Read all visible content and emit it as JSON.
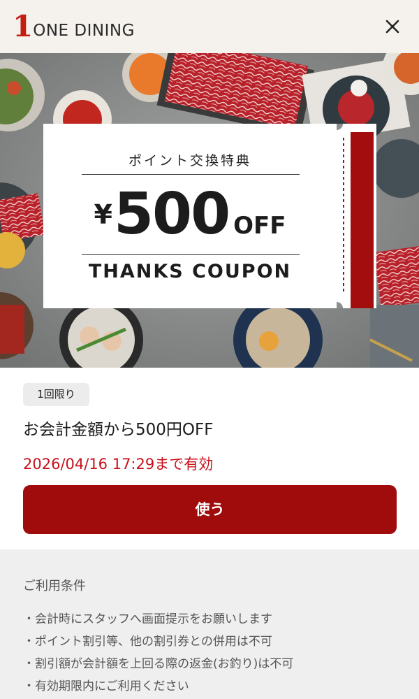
{
  "header": {
    "logo_number": "1",
    "logo_text": "ONE DINING",
    "close_icon": "close-icon"
  },
  "hero": {
    "description_icon": "food-platter-photo"
  },
  "coupon_card": {
    "title": "ポイント交換特典",
    "currency": "¥",
    "amount": "500",
    "off": "OFF",
    "subtitle": "THANKS COUPON"
  },
  "coupon_info": {
    "badge": "1回限り",
    "description": "お会計金額から500円OFF",
    "expiry": "2026/04/16 17:29まで有効",
    "use_button": "使う"
  },
  "terms": {
    "title": "ご利用条件",
    "items": [
      "会計時にスタッフへ画面提示をお願いします",
      "ポイント割引等、他の割引券との併用は不可",
      "割引額が会計額を上回る際の返金(お釣り)は不可",
      "有効期限内にご利用ください"
    ]
  },
  "colors": {
    "brand_red": "#c41c10",
    "button_red": "#a00b0b",
    "expiry_red": "#c8101a",
    "header_bg": "#f5f1ec",
    "terms_bg": "#efefef"
  }
}
